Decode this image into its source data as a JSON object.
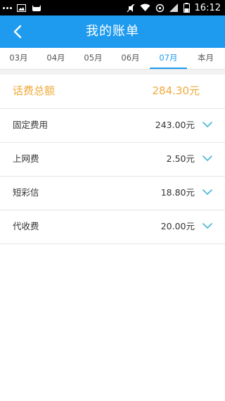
{
  "status_bar": {
    "time": "16:12",
    "icons": [
      "more-dots-icon",
      "image-icon",
      "cat-icon",
      "mute-icon",
      "wifi-icon",
      "sync-icon",
      "signal-icon",
      "battery-icon"
    ]
  },
  "header": {
    "title": "我的账单",
    "back_icon": "chevron-left-icon",
    "background": "#1e9bef"
  },
  "month_tabs": {
    "items": [
      "03月",
      "04月",
      "05月",
      "06月",
      "07月",
      "本月"
    ],
    "selected": "07月",
    "accent": "#1e9bef"
  },
  "total": {
    "label": "话费总额",
    "value": "284.30元",
    "color": "#f0a93a"
  },
  "items": [
    {
      "label": "固定费用",
      "value": "243.00元"
    },
    {
      "label": "上网费",
      "value": "2.50元"
    },
    {
      "label": "短彩信",
      "value": "18.80元"
    },
    {
      "label": "代收费",
      "value": "20.00元"
    }
  ]
}
